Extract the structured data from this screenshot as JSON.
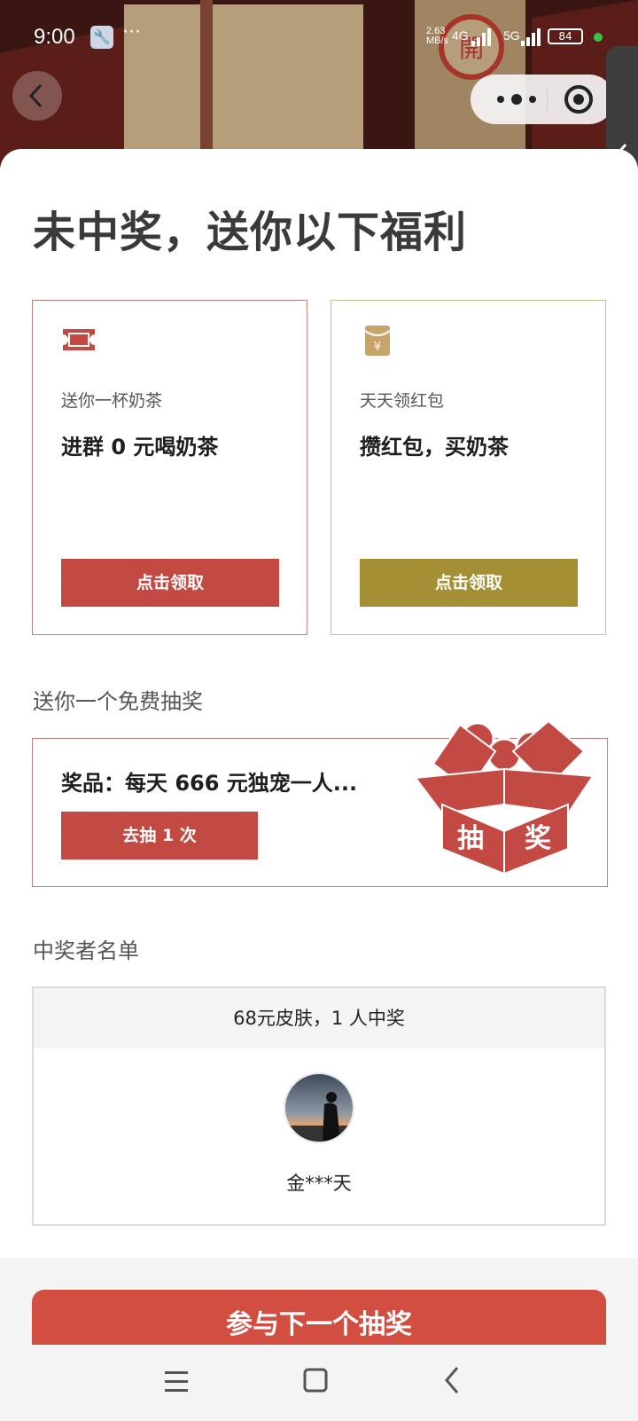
{
  "status_bar": {
    "time": "9:00",
    "dots": "···",
    "net_speed_top": "2.63",
    "net_speed_bottom": "MB/s",
    "net_type_1": "4G",
    "net_type_2": "5G",
    "battery": "84"
  },
  "background": {
    "seal_char": "開"
  },
  "headline": "未中奖，送你以下福利",
  "cards": [
    {
      "subtitle": "送你一杯奶茶",
      "title": "进群 0 元喝奶茶",
      "button": "点击领取",
      "icon": "ticket-icon",
      "accent": "#c34a42"
    },
    {
      "subtitle": "天天领红包",
      "title": "攒红包，买奶茶",
      "button": "点击领取",
      "icon": "red-envelope-icon",
      "accent": "#a48f34"
    }
  ],
  "free_lottery": {
    "label": "送你一个免费抽奖",
    "prize": "奖品：每天 666 元独宠一人...",
    "button": "去抽 1 次",
    "box_left_char": "抽",
    "box_right_char": "奖"
  },
  "winners": {
    "label": "中奖者名单",
    "header": "68元皮肤，1 人中奖",
    "name": "金***天"
  },
  "cta": "参与下一个抽奖",
  "icons": {
    "back": "chevron-left-icon",
    "more": "more-dots-icon",
    "close": "target-close-icon",
    "side": "chevron-left-icon"
  }
}
